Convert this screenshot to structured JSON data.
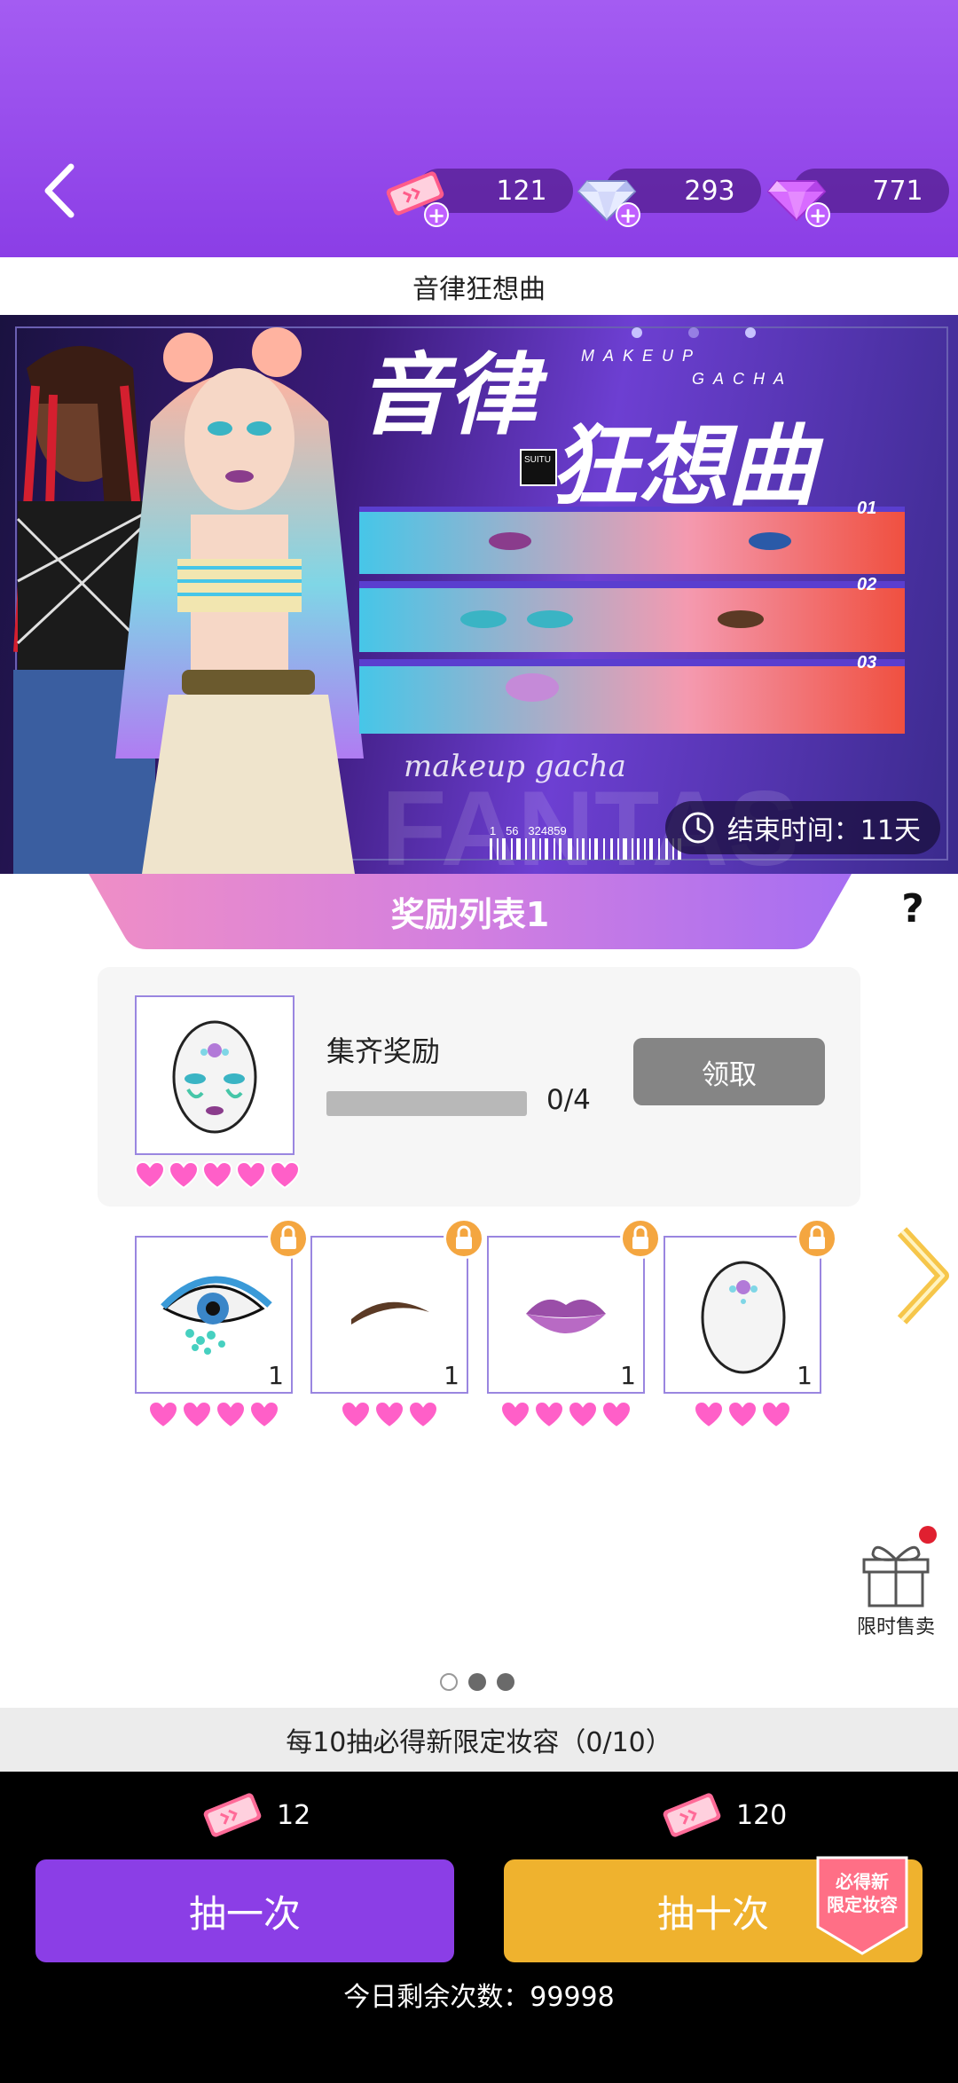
{
  "currencies": [
    {
      "icon": "ticket-icon",
      "value": "121"
    },
    {
      "icon": "diamond-icon",
      "value": "293"
    },
    {
      "icon": "gem-icon",
      "value": "771"
    }
  ],
  "page_title": "音律狂想曲",
  "banner": {
    "logo_title_1": "音律",
    "logo_title_2": "狂想曲",
    "makeup_text": "MAKEUP",
    "gacha_text": "GACHA",
    "suitu": "SUITU",
    "strip_numbers": [
      "01",
      "02",
      "03"
    ],
    "script_text": "makeup gacha",
    "bg_word": "FANTAS",
    "barcode_numbers": "1   56   324859",
    "end_time_label": "结束时间：11天"
  },
  "reward_list": {
    "title": "奖励列表1",
    "help": "?"
  },
  "collect": {
    "title": "集齐奖励",
    "progress": "0/4",
    "progress_fraction": 0,
    "claim_label": "领取",
    "hearts": 5
  },
  "items": [
    {
      "name": "eye-makeup",
      "count": "1",
      "hearts": 4,
      "locked": true
    },
    {
      "name": "eyebrow",
      "count": "1",
      "hearts": 3,
      "locked": true
    },
    {
      "name": "lips",
      "count": "1",
      "hearts": 4,
      "locked": true
    },
    {
      "name": "forehead-jewel",
      "count": "1",
      "hearts": 3,
      "locked": true
    }
  ],
  "gift": {
    "label": "限时售卖"
  },
  "pager": {
    "pages": 3,
    "current": 0
  },
  "guarantee_text": "每10抽必得新限定妆容（0/10）",
  "draw_one": {
    "cost": "12",
    "label": "抽一次"
  },
  "draw_ten": {
    "cost": "120",
    "label": "抽十次",
    "badge_line1": "必得新",
    "badge_line2": "限定妆容"
  },
  "remaining_text": "今日剩余次数：99998",
  "colors": {
    "purple": "#8b3ee6",
    "gold": "#efb22e",
    "pink": "#ff5fc8",
    "lock": "#f4a640"
  }
}
